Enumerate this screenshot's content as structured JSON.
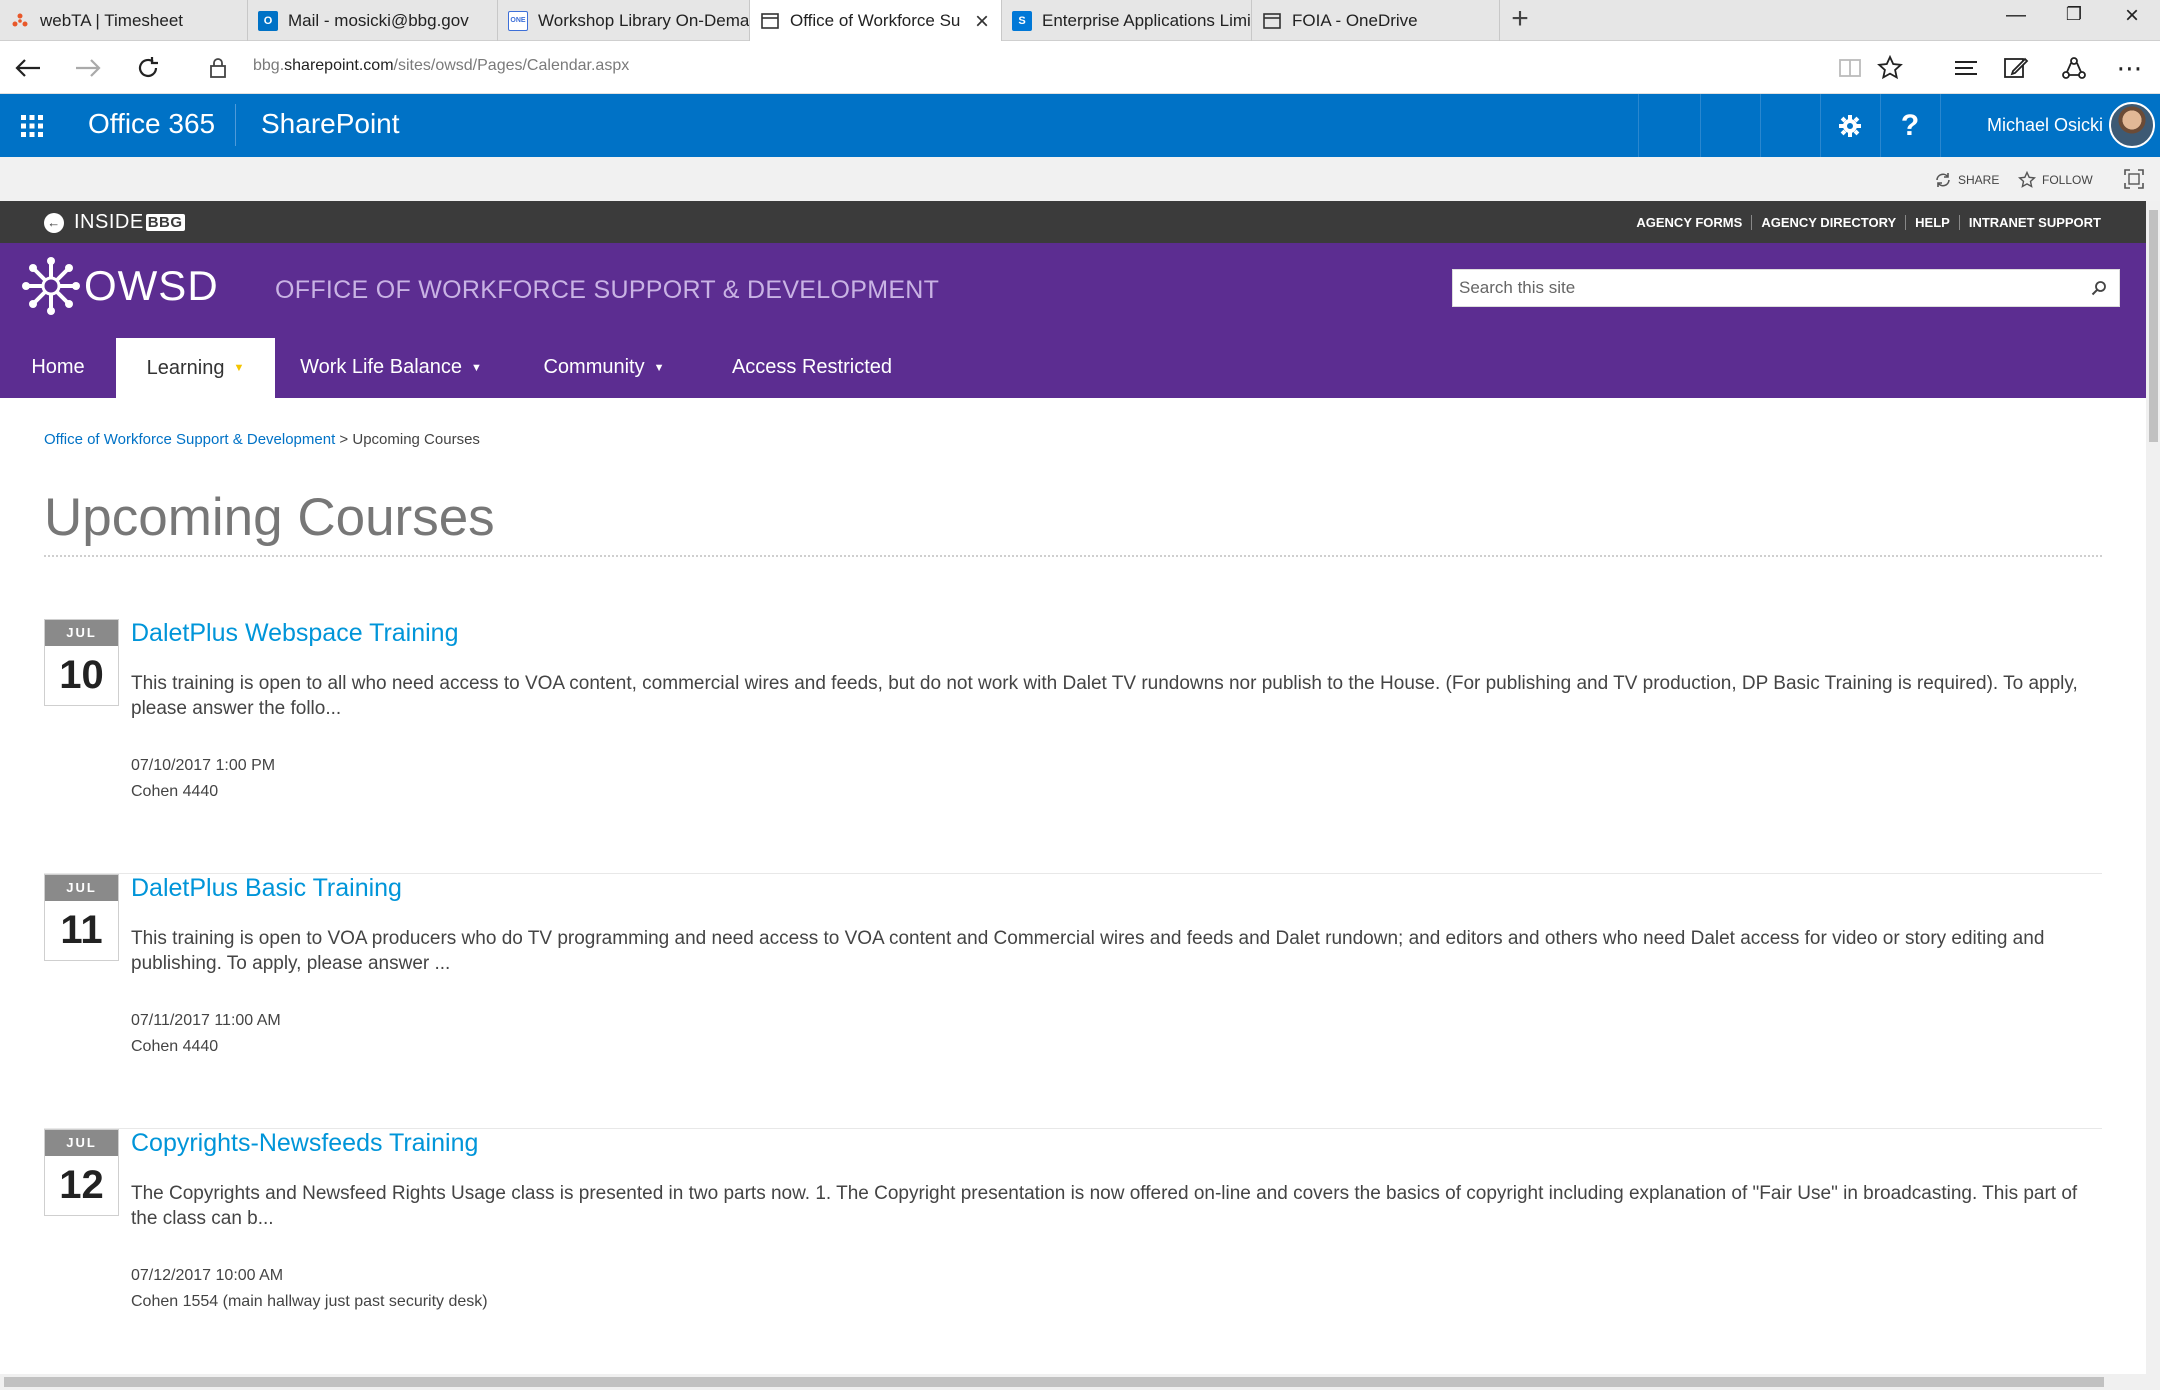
{
  "browser": {
    "tabs": [
      {
        "title": "webTA | Timesheet",
        "favicon": "webta-icon",
        "color": "#e8582a",
        "active": false
      },
      {
        "title": "Mail - mosicki@bbg.gov",
        "favicon": "outlook-icon",
        "color": "#0072c6",
        "active": false
      },
      {
        "title": "Workshop Library On-Demand",
        "favicon": "workshop-icon",
        "color": "#3d6fd8",
        "active": false
      },
      {
        "title": "Office of Workforce Support",
        "favicon": "page-icon",
        "color": "#444444",
        "active": true
      },
      {
        "title": "Enterprise Applications Limi",
        "favicon": "sharepoint-icon",
        "color": "#0078d7",
        "active": false
      },
      {
        "title": "FOIA - OneDrive",
        "favicon": "page-icon",
        "color": "#444444",
        "active": false
      }
    ],
    "url_prefix": "bbg.",
    "url_domain": "sharepoint.com",
    "url_path": "/sites/owsd/Pages/Calendar.aspx"
  },
  "suitebar": {
    "brand": "Office 365",
    "app": "SharePoint",
    "user": "Michael Osicki",
    "help_label": "?"
  },
  "ribbon": {
    "share": "SHARE",
    "follow": "FOLLOW"
  },
  "globalbar": {
    "inside_label": "INSIDE",
    "bbg_label": "BBG",
    "links": [
      "AGENCY FORMS",
      "AGENCY DIRECTORY",
      "HELP",
      "INTRANET SUPPORT"
    ]
  },
  "header": {
    "logo_text": "OWSD",
    "site_title": "OFFICE OF WORKFORCE SUPPORT & DEVELOPMENT",
    "search_placeholder": "Search this site"
  },
  "topnav": [
    {
      "label": "Home",
      "has_menu": false,
      "active": false
    },
    {
      "label": "Learning",
      "has_menu": true,
      "active": true
    },
    {
      "label": "Work Life Balance",
      "has_menu": true,
      "active": false
    },
    {
      "label": "Community",
      "has_menu": true,
      "active": false
    },
    {
      "label": "Access Restricted",
      "has_menu": false,
      "active": false
    }
  ],
  "breadcrumb": {
    "parent": "Office of Workforce Support & Development",
    "separator": ">",
    "current": "Upcoming Courses"
  },
  "page": {
    "title": "Upcoming Courses"
  },
  "events": [
    {
      "month": "JUL",
      "day": "10",
      "title": "DaletPlus Webspace Training",
      "description": "This training is open to all who need access to VOA content, commercial wires and feeds, but do not work with Dalet TV rundowns nor publish to the House. (For publishing and TV production, DP Basic Training is required). To apply, please answer the follo...",
      "datetime": "07/10/2017 1:00 PM",
      "location": "Cohen 4440"
    },
    {
      "month": "JUL",
      "day": "11",
      "title": "DaletPlus Basic Training",
      "description": "This training is open to VOA producers who do TV programming and need access to VOA content and Commercial wires and feeds and Dalet rundown; and editors and others who need Dalet access for video or story editing and publishing. To apply, please answer ...",
      "datetime": "07/11/2017 11:00 AM",
      "location": "Cohen 4440"
    },
    {
      "month": "JUL",
      "day": "12",
      "title": "Copyrights-Newsfeeds Training",
      "description": "The Copyrights and Newsfeed Rights Usage class is presented in two parts now. 1. The Copyright presentation is now offered on-line and covers the basics of copyright including explanation of \"Fair Use\" in broadcasting. This part of the class can b...",
      "datetime": "07/12/2017 10:00 AM",
      "location": "Cohen 1554 (main hallway just past security desk)"
    }
  ],
  "colors": {
    "suite_blue": "#0072c6",
    "owsd_purple": "#5c2d91",
    "link_blue": "#0095d9",
    "caret_gold": "#f4c400"
  }
}
